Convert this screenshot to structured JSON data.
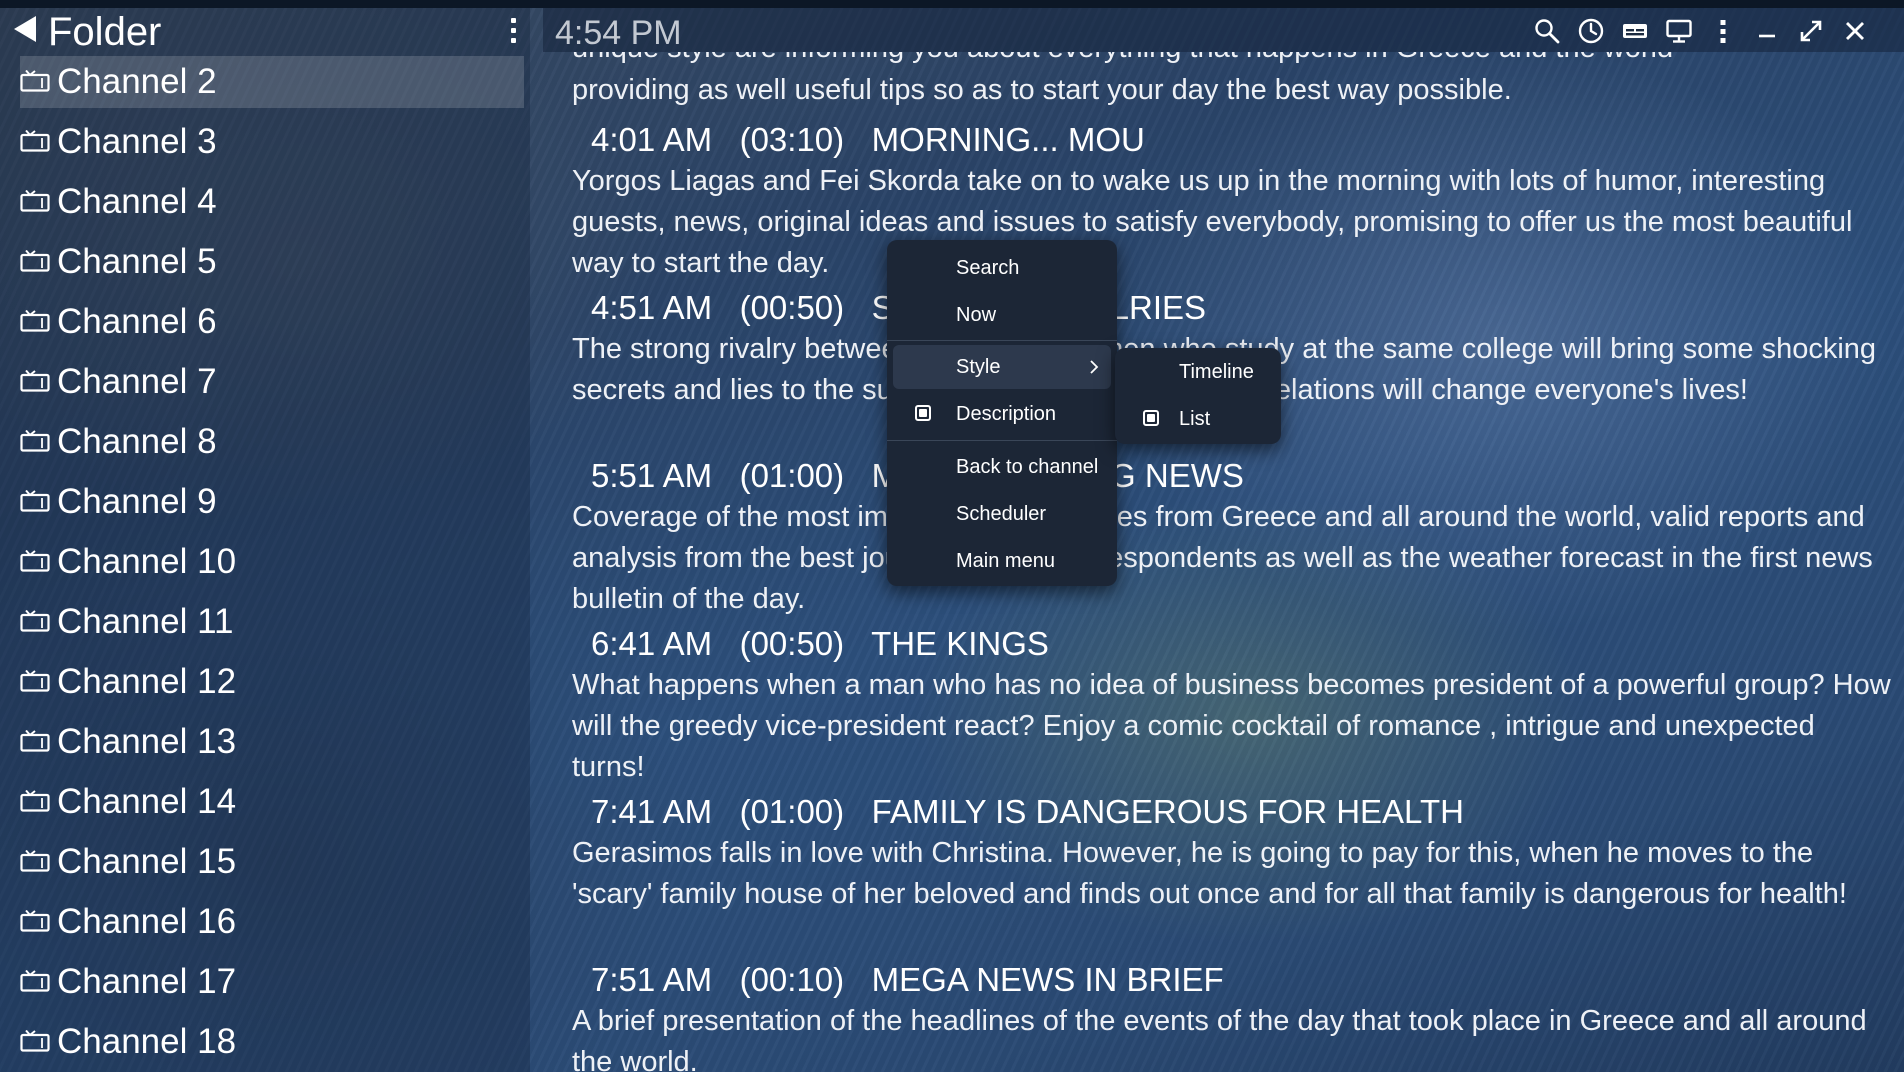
{
  "sidebar": {
    "title": "Folder",
    "channels": [
      {
        "label": "Channel 2",
        "selected": true
      },
      {
        "label": "Channel 3"
      },
      {
        "label": "Channel 4"
      },
      {
        "label": "Channel 5"
      },
      {
        "label": "Channel 6"
      },
      {
        "label": "Channel 7"
      },
      {
        "label": "Channel 8"
      },
      {
        "label": "Channel 9"
      },
      {
        "label": "Channel 10"
      },
      {
        "label": "Channel 11"
      },
      {
        "label": "Channel 12"
      },
      {
        "label": "Channel 13"
      },
      {
        "label": "Channel 14"
      },
      {
        "label": "Channel 15"
      },
      {
        "label": "Channel 16"
      },
      {
        "label": "Channel 17"
      },
      {
        "label": "Channel 18"
      }
    ]
  },
  "topbar": {
    "time": "4:54 PM",
    "icons": [
      "search-icon",
      "clock-icon",
      "subtitles-icon",
      "monitor-icon",
      "more-icon",
      "minimize-icon",
      "maximize-icon",
      "close-icon"
    ]
  },
  "epg": {
    "partial_lines": [
      "unique style are informing you about everything that happens in Greece and the world",
      "providing as well useful tips so as to start your day the best way possible."
    ],
    "programs": [
      {
        "time": "4:01 AM",
        "duration": "(03:10)",
        "title": "MORNING... MOU",
        "description": "Yorgos Liagas and Fei Skorda take on to wake us up in the morning with lots of humor, interesting guests, news, original ideas and issues to satisfy everybody, promising to offer us the most beautiful way to start the day."
      },
      {
        "time": "4:51 AM",
        "duration": "(00:50)",
        "title": "STUDENT RIVALRIES",
        "description": "The strong rivalry between two young women who study at the same college will bring some shocking secrets and lies to the surface and an avalanche of revelations will change everyone's lives!"
      },
      {
        "time": "5:51 AM",
        "duration": "(01:00)",
        "title": "MEGA MORNING NEWS",
        "description": "Coverage of the most important news stories from Greece and all around the world, valid reports and analysis from the best journalists and correspondents as well as the weather forecast in the first news bulletin of the day."
      },
      {
        "time": "6:41 AM",
        "duration": "(00:50)",
        "title": "THE KINGS",
        "description": "What happens when a man who has no idea of business becomes president of a powerful group? How will the greedy vice-president react? Enjoy a comic cocktail of romance , intrigue and unexpected turns!"
      },
      {
        "time": "7:41 AM",
        "duration": "(01:00)",
        "title": "FAMILY IS DANGEROUS FOR HEALTH",
        "description": "Gerasimos falls in love with Christina. However, he is going to pay for this, when he moves to the 'scary' family house of her beloved and finds out once and for all that family is dangerous for health!"
      },
      {
        "time": "7:51 AM",
        "duration": "(00:10)",
        "title": "MEGA NEWS IN BRIEF",
        "description": "A brief presentation of the headlines of the events of the day that took place in Greece and all around the world."
      }
    ]
  },
  "context_menu": {
    "items": {
      "search": "Search",
      "now": "Now",
      "style": "Style",
      "description": "Description",
      "back_to_channel": "Back to channel",
      "scheduler": "Scheduler",
      "main_menu": "Main menu"
    },
    "description_checked": true,
    "style_submenu": {
      "timeline": "Timeline",
      "list": "List",
      "list_checked": true
    }
  },
  "colors": {
    "menu_bg": "#1c2636",
    "menu_hover": "#2d394d",
    "text": "#ffffff",
    "clock_text": "#c3c9d2"
  }
}
